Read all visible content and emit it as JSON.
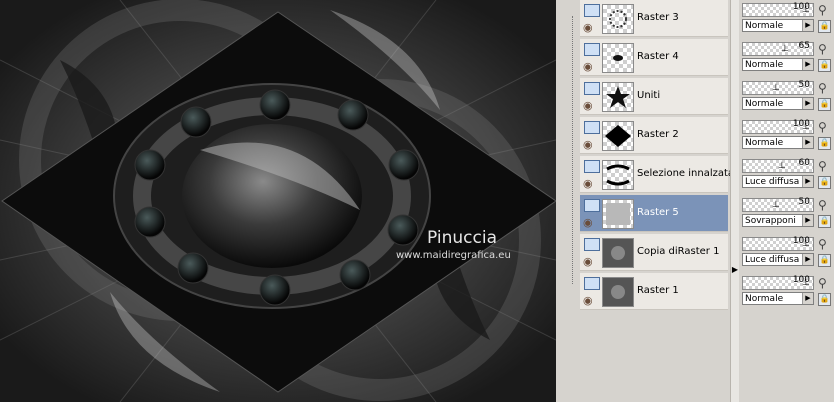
{
  "canvas": {
    "watermark_title": "Pinuccia",
    "watermark_url": "www.maidiregrafica.eu"
  },
  "layers": [
    {
      "name": "Raster 3",
      "opacity": "100",
      "blend": "Normale",
      "selected": false,
      "thumb": "ring"
    },
    {
      "name": "Raster 4",
      "opacity": "65",
      "blend": "Normale",
      "selected": false,
      "thumb": "dot"
    },
    {
      "name": "Uniti",
      "opacity": "50",
      "blend": "Normale",
      "selected": false,
      "thumb": "star"
    },
    {
      "name": "Raster 2",
      "opacity": "100",
      "blend": "Normale",
      "selected": false,
      "thumb": "diamond"
    },
    {
      "name": "Selezione innalzata",
      "opacity": "60",
      "blend": "Luce diffusa",
      "selected": false,
      "thumb": "arc"
    },
    {
      "name": "Raster 5",
      "opacity": "50",
      "blend": "Sovrapponi",
      "selected": true,
      "thumb": "grey"
    },
    {
      "name": "Copia diRaster 1",
      "opacity": "100",
      "blend": "Luce diffusa",
      "selected": false,
      "thumb": "texture"
    },
    {
      "name": "Raster 1",
      "opacity": "100",
      "blend": "Normale",
      "selected": false,
      "thumb": "texture"
    }
  ],
  "icons": {
    "visibility": "eye-icon",
    "layer_type": "raster-layer-icon",
    "dropdown": "triangle-right-icon",
    "link": "link-icon",
    "lock": "lock-icon"
  },
  "colors": {
    "selected_row": "#7b93b8",
    "panel_bg": "#d6d3ce"
  }
}
